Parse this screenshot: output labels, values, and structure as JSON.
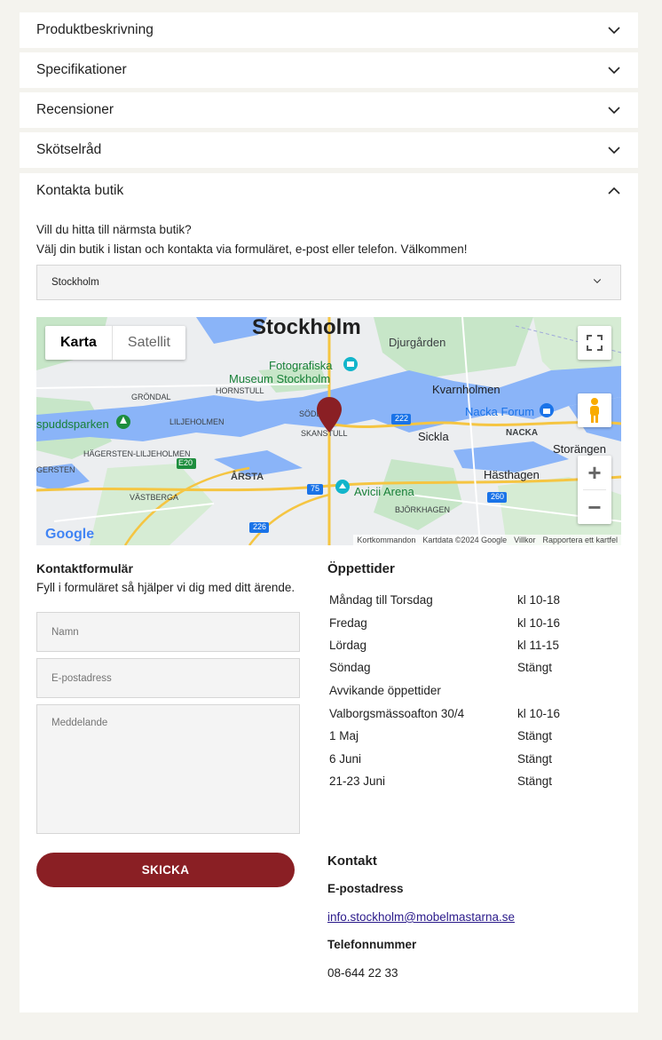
{
  "accordion": [
    {
      "title": "Produktbeskrivning"
    },
    {
      "title": "Specifikationer"
    },
    {
      "title": "Recensioner"
    },
    {
      "title": "Skötselråd"
    }
  ],
  "contact_section": {
    "title": "Kontakta butik",
    "intro_line1": "Vill du hitta till närmsta butik?",
    "intro_line2": "Välj din butik i listan och kontakta via formuläret, e-post eller telefon. Välkommen!",
    "store_select_value": "Stockholm"
  },
  "map": {
    "tab_map": "Karta",
    "tab_satellite": "Satellit",
    "city_label": "Stockholm",
    "labels": {
      "djurgarden": "Djurgården",
      "fotografiska": "Fotografiska",
      "museum": "Museum Stockholm",
      "kvarnholmen": "Kvarnholmen",
      "grondal": "GRÖNDAL",
      "hornstull": "HORNSTULL",
      "sodermalm": "SÖDERMA",
      "skanstull": "SKANSTULL",
      "nacka_forum": "Nacka Forum",
      "spuddsparken": "spuddsparken",
      "liljeholmen": "LILJEHOLMEN",
      "sickla": "Sickla",
      "nacka": "NACKA",
      "hagersten": "HÄGERSTEN-LILJEHOLMEN",
      "strangen": "Storängen",
      "gersten": "GERSTEN",
      "arsta": "ÅRSTA",
      "hasthagen": "Hästhagen",
      "vastberga": "VÄSTBERGA",
      "avicii": "Avicii Arena",
      "bjorkhagen": "BJÖRKHAGEN",
      "e20": "E20",
      "r222": "222",
      "r75": "75",
      "r260": "260",
      "r226": "226"
    },
    "google": "Google",
    "attribution": [
      "Kortkommandon",
      "Kartdata ©2024 Google",
      "Villkor",
      "Rapportera ett kartfel"
    ]
  },
  "form": {
    "title": "Kontaktformulär",
    "subtitle": "Fyll i formuläret så hjälper vi dig med ditt ärende.",
    "name_placeholder": "Namn",
    "email_placeholder": "E-postadress",
    "message_placeholder": "Meddelande",
    "submit_label": "SKICKA"
  },
  "hours": {
    "title": "Öppettider",
    "regular": [
      {
        "day": "Måndag till Torsdag",
        "time": "kl 10-18"
      },
      {
        "day": "Fredag",
        "time": "kl 10-16"
      },
      {
        "day": "Lördag",
        "time": "kl 11-15"
      },
      {
        "day": "Söndag",
        "time": "Stängt"
      }
    ],
    "deviating_title": "Avvikande öppettider",
    "deviating": [
      {
        "day": "Valborgsmässoafton 30/4",
        "time": "kl 10-16"
      },
      {
        "day": "1 Maj",
        "time": "Stängt"
      },
      {
        "day": "6 Juni",
        "time": "Stängt"
      },
      {
        "day": "21-23 Juni",
        "time": "Stängt"
      }
    ]
  },
  "contact": {
    "title": "Kontakt",
    "email_label": "E-postadress",
    "email": "info.stockholm@mobelmastarna.se",
    "phone_label": "Telefonnummer",
    "phone": "08-644 22 33"
  },
  "colors": {
    "accent": "#8a1f24",
    "background": "#f4f3ee",
    "link": "#2a1a8a"
  }
}
